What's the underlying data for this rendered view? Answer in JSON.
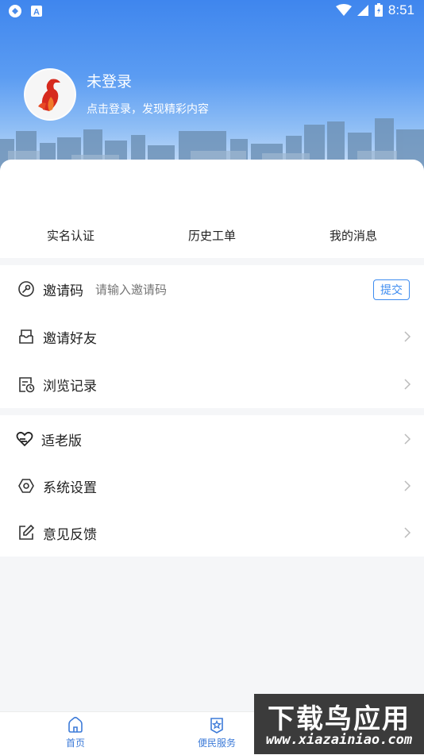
{
  "statusbar": {
    "time": "8:51"
  },
  "profile": {
    "name": "未登录",
    "subtitle": "点击登录，发现精彩内容"
  },
  "quick_links": [
    {
      "label": "实名认证"
    },
    {
      "label": "历史工单"
    },
    {
      "label": "我的消息"
    }
  ],
  "invite": {
    "label": "邀请码",
    "placeholder": "请输入邀请码",
    "submit": "提交"
  },
  "menu1": [
    {
      "label": "邀请好友",
      "icon": "mail-icon"
    },
    {
      "label": "浏览记录",
      "icon": "history-icon"
    }
  ],
  "menu2": [
    {
      "label": "适老版",
      "icon": "heart-hands-icon"
    },
    {
      "label": "系统设置",
      "icon": "settings-icon"
    },
    {
      "label": "意见反馈",
      "icon": "feedback-icon"
    }
  ],
  "tabbar": [
    {
      "label": "首页",
      "icon": "home-icon"
    },
    {
      "label": "便民服务",
      "icon": "service-icon"
    }
  ],
  "watermark": {
    "title": "下载鸟应用",
    "url": "www.xiazainiao.com"
  },
  "colors": {
    "accent": "#3d8cf0",
    "header_top": "#3f86ee",
    "background": "#f5f6f8"
  }
}
